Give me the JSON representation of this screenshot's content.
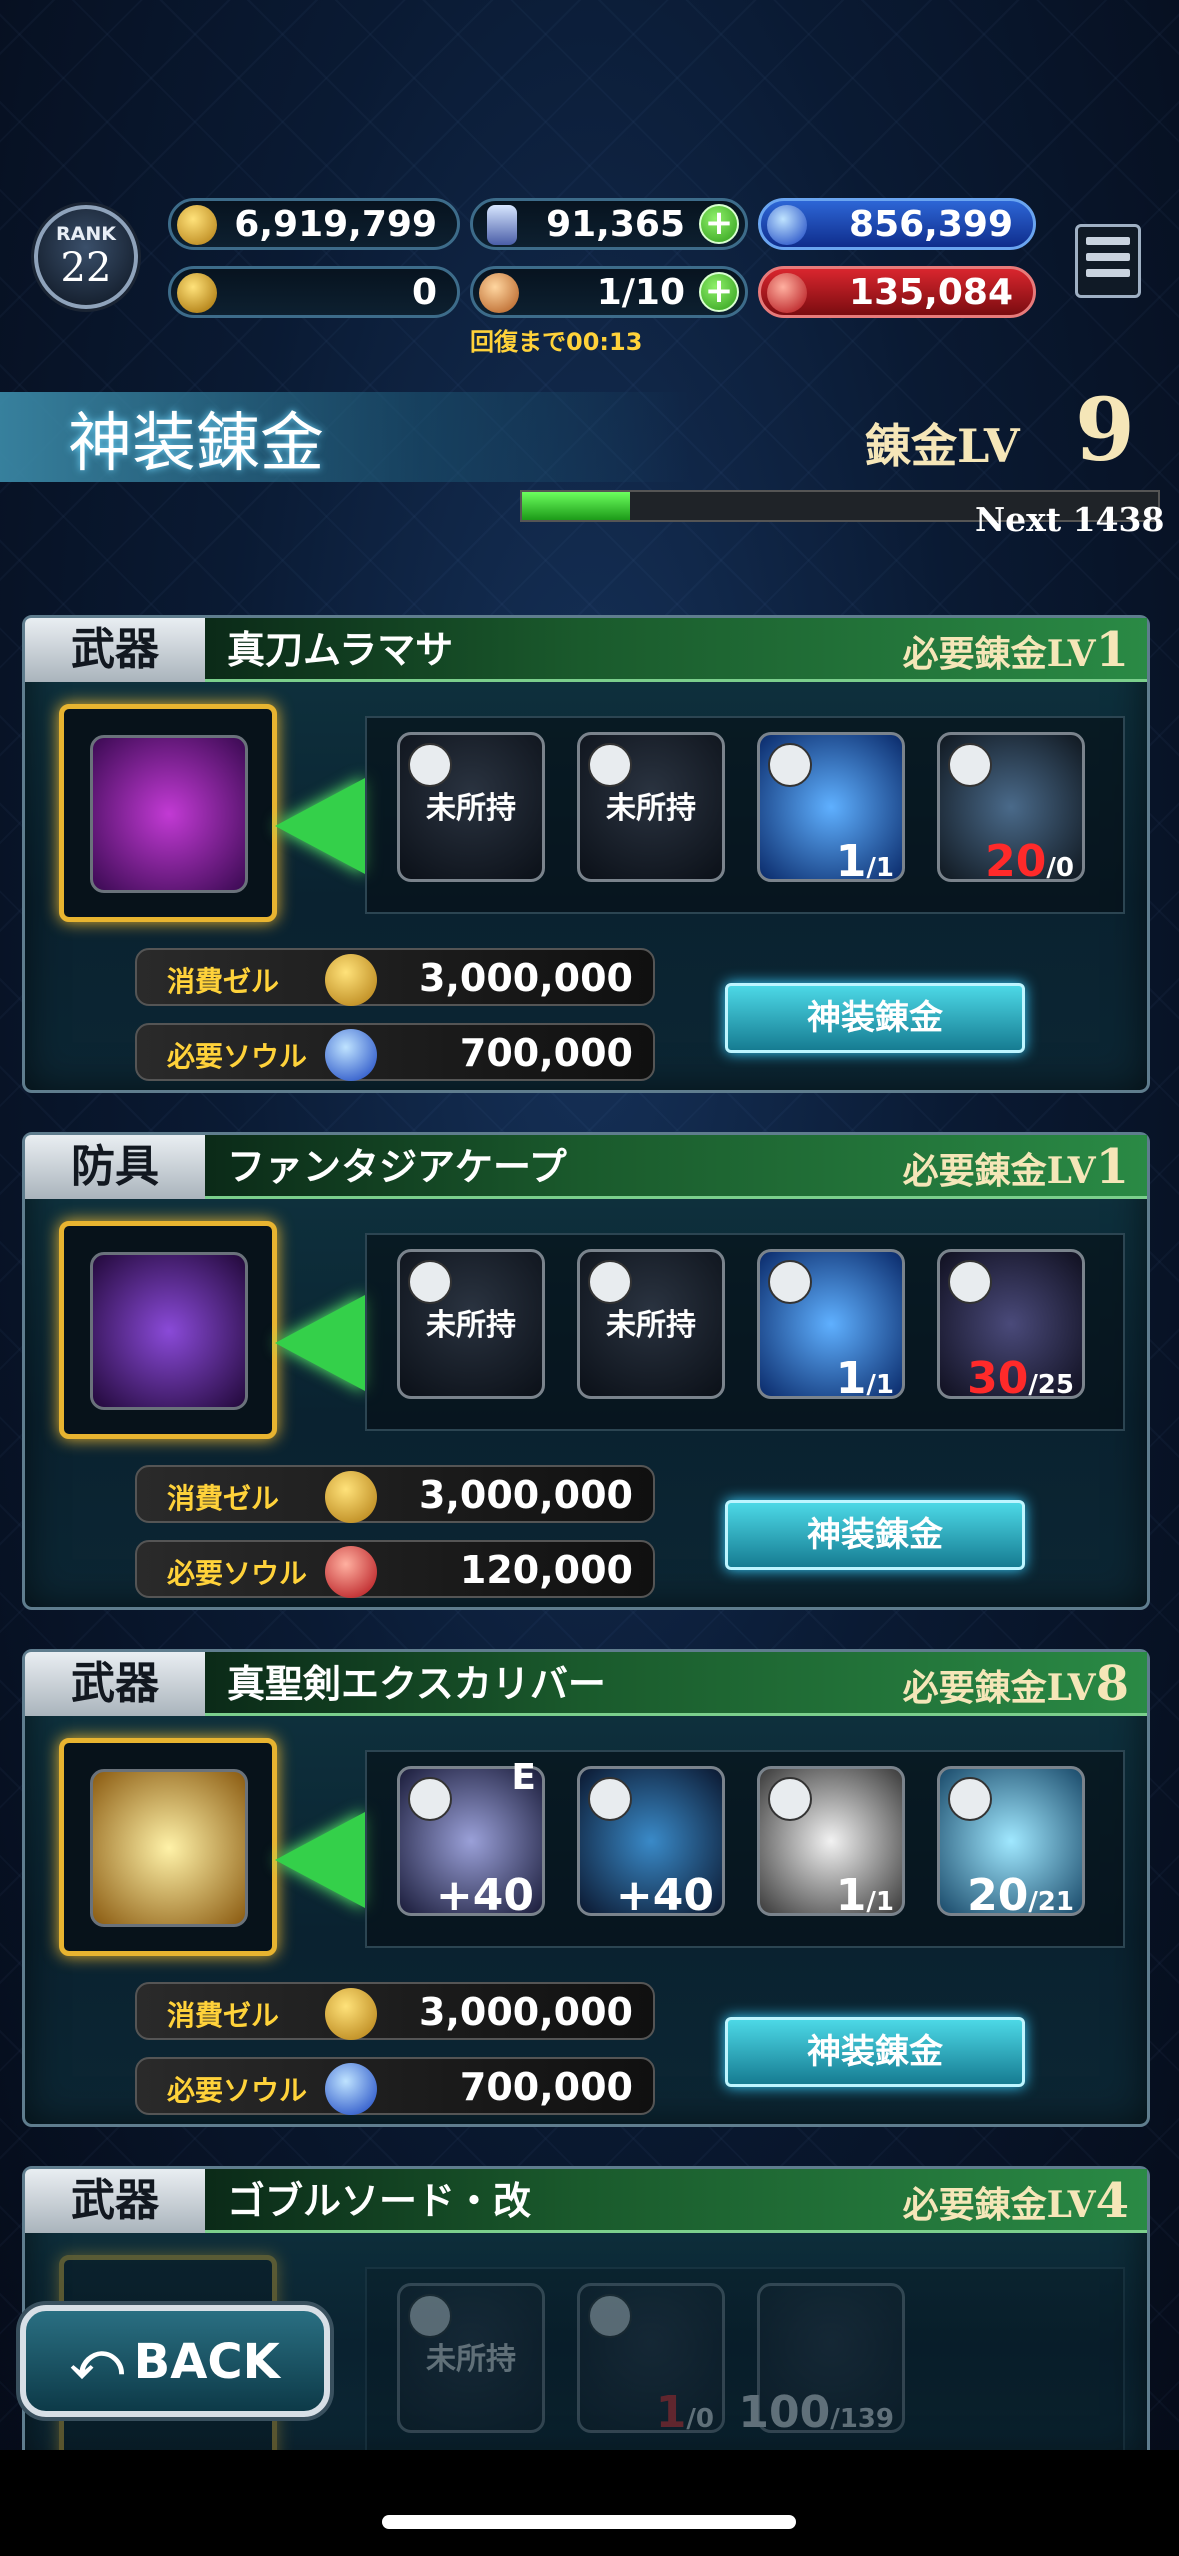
{
  "header": {
    "rank_label": "RANK",
    "rank_value": "22",
    "gil": "6,919,799",
    "crystals": "91,365",
    "blue_soul": "856,399",
    "trophy": "0",
    "stamina": "1/10",
    "red_soul": "135,084",
    "recovery": "回復まで00:13"
  },
  "title": "神装錬金",
  "alchemy": {
    "label": "錬金LV",
    "level": "9",
    "next_label": "Next",
    "next_value": "1438",
    "progress": 0.17
  },
  "cards": [
    {
      "category": "武器",
      "name": "真刀ムラマサ",
      "req_label": "必要錬金LV",
      "req_level": "1",
      "mats": [
        {
          "label": "未所持"
        },
        {
          "label": "未所持"
        },
        {
          "count": "1",
          "total": "/1"
        },
        {
          "count": "20",
          "total": "/0",
          "short": true
        }
      ],
      "cost_zel_label": "消費ゼル",
      "cost_zel": "3,000,000",
      "cost_soul_label": "必要ソウル",
      "cost_soul": "700,000",
      "button": "神装錬金"
    },
    {
      "category": "防具",
      "name": "ファンタジアケープ",
      "req_label": "必要錬金LV",
      "req_level": "1",
      "mats": [
        {
          "label": "未所持"
        },
        {
          "label": "未所持"
        },
        {
          "count": "1",
          "total": "/1"
        },
        {
          "count": "30",
          "total": "/25"
        }
      ],
      "cost_zel_label": "消費ゼル",
      "cost_zel": "3,000,000",
      "cost_soul_label": "必要ソウル",
      "cost_soul": "120,000",
      "button": "神装錬金"
    },
    {
      "category": "武器",
      "name": "真聖剣エクスカリバー",
      "req_label": "必要錬金LV",
      "req_level": "8",
      "mats": [
        {
          "label": "+40",
          "tag": "E"
        },
        {
          "label": "+40"
        },
        {
          "count": "1",
          "total": "/1"
        },
        {
          "count": "20",
          "total": "/21"
        }
      ],
      "cost_zel_label": "消費ゼル",
      "cost_zel": "3,000,000",
      "cost_soul_label": "必要ソウル",
      "cost_soul": "700,000",
      "button": "神装錬金"
    },
    {
      "category": "武器",
      "name": "ゴブルソード・改",
      "req_label": "必要錬金LV",
      "req_level": "4",
      "mats": [
        {
          "label": "未所持"
        },
        {
          "count": "1",
          "total": "/0"
        },
        {
          "count": "100",
          "total": "/139"
        }
      ]
    }
  ],
  "back_label": "BACK"
}
